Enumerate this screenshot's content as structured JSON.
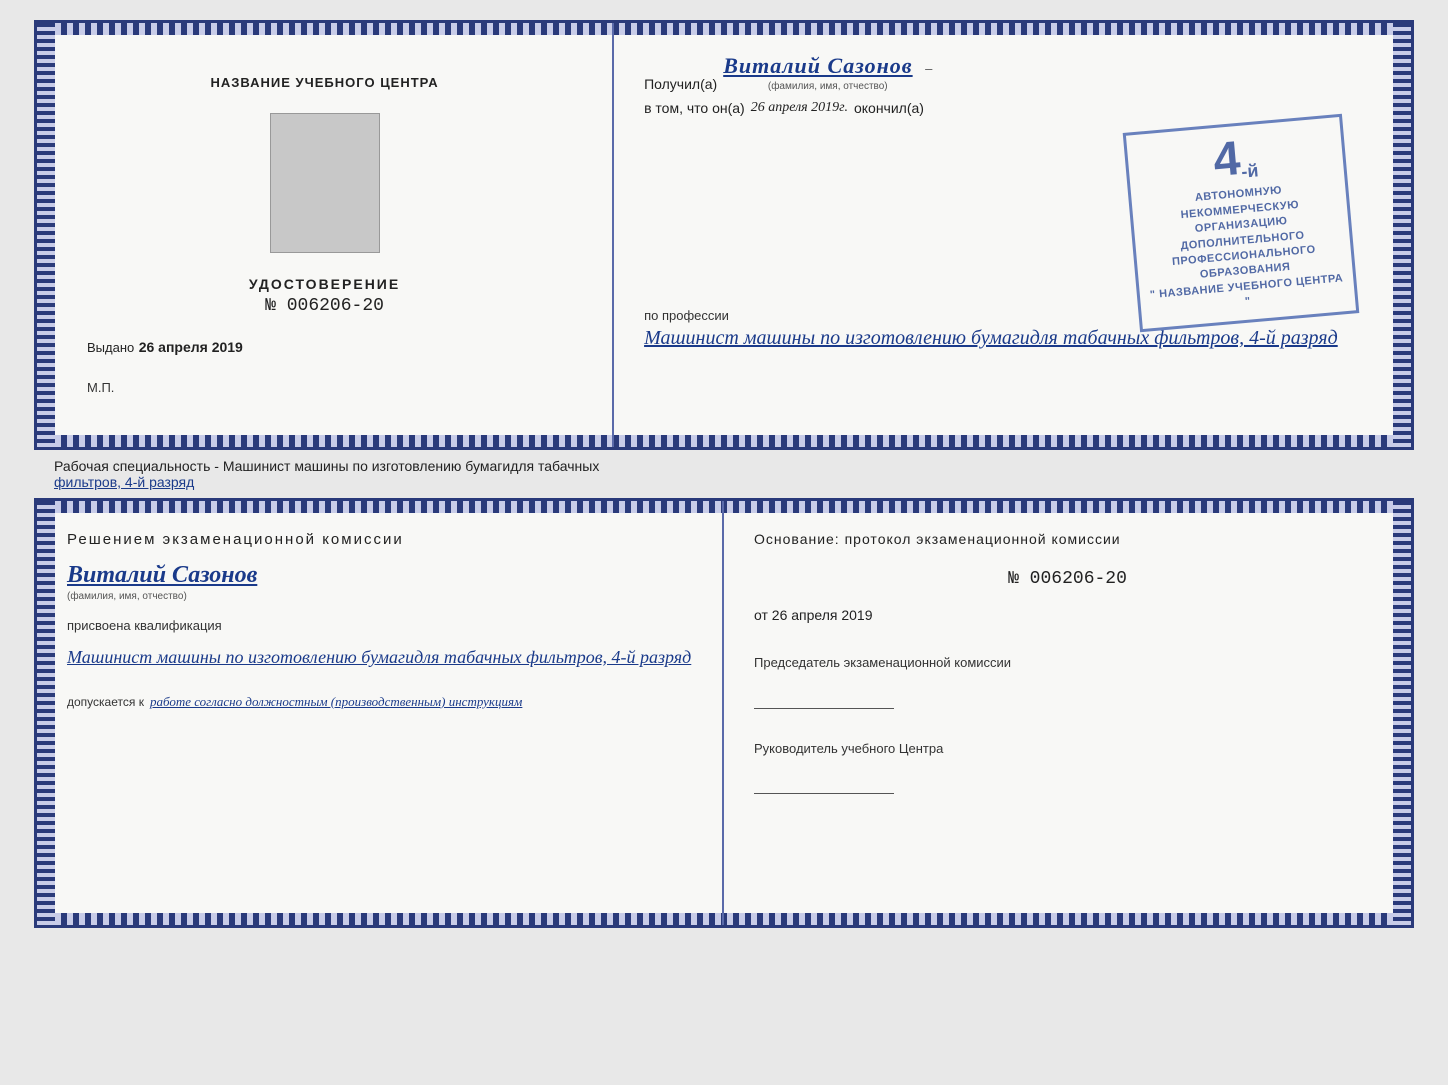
{
  "top_certificate": {
    "left": {
      "org_name": "НАЗВАНИЕ УЧЕБНОГО ЦЕНТРА",
      "cert_title": "УДОСТОВЕРЕНИЕ",
      "cert_number": "№ 006206-20",
      "issued_label": "Выдано",
      "issued_date": "26 апреля 2019",
      "mp_label": "М.П."
    },
    "right": {
      "recipient_prefix": "Получил(а)",
      "recipient_name": "Виталий Сазонов",
      "recipient_subtitle": "(фамилия, имя, отчество)",
      "date_prefix": "в том, что он(а)",
      "date_value": "26 апреля 2019г.",
      "date_suffix": "окончил(а)",
      "stamp_number": "4",
      "stamp_suffix": "-й",
      "stamp_line1": "АВТОНОМНУЮ НЕКОММЕРЧЕСКУЮ ОРГАНИЗАЦИЮ",
      "stamp_line2": "ДОПОЛНИТЕЛЬНОГО ПРОФЕССИОНАЛЬНОГО ОБРАЗОВАНИЯ",
      "stamp_line3": "\" НАЗВАНИЕ УЧЕБНОГО ЦЕНТРА \"",
      "profession_label": "по профессии",
      "profession_text": "Машинист машины по изготовлению бумагидля табачных фильтров, 4-й разряд"
    }
  },
  "middle_text": {
    "prefix": "Рабочая специальность - Машинист машины по изготовлению бумагидля табачных",
    "underline_text": "фильтров, 4-й разряд"
  },
  "bottom_certificate": {
    "left": {
      "commission_title": "Решением  экзаменационной  комиссии",
      "person_name": "Виталий Сазонов",
      "person_subtitle": "(фамилия, имя, отчество)",
      "qualification_label": "присвоена квалификация",
      "qualification_text": "Машинист машины по изготовлению бумагидля табачных фильтров, 4-й разряд",
      "admission_prefix": "допускается к",
      "admission_text": "работе согласно должностным (производственным) инструкциям"
    },
    "right": {
      "basis_label": "Основание:  протокол  экзаменационной  комиссии",
      "protocol_number": "№  006206-20",
      "protocol_date_prefix": "от",
      "protocol_date": "26 апреля 2019",
      "chairman_label": "Председатель экзаменационной комиссии",
      "director_label": "Руководитель учебного Центра"
    }
  }
}
